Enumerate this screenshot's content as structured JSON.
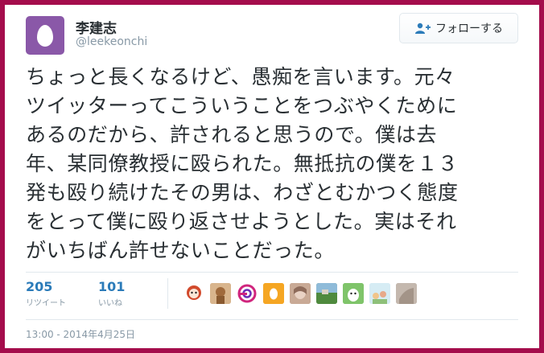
{
  "user": {
    "display_name": "李建志",
    "handle": "@leekeonchi"
  },
  "follow_button": {
    "label": "フォローする",
    "icon": "person-plus-icon"
  },
  "tweet": {
    "text": "ちょっと長くなるけど、愚痴を言います。元々\nツイッターってこういうことをつぶやくために\nあるのだから、許されると思うので。僕は去\n年、某同僚教授に殴られた。無抵抗の僕を１３\n発も殴り続けたその男は、わざとむかつく態度\nをとって僕に殴り返させようとした。実はそれ\nがいちばん許せないことだった。"
  },
  "stats": {
    "retweets": {
      "count": "205",
      "label": "リツイート"
    },
    "likes": {
      "count": "101",
      "label": "いいね"
    }
  },
  "timestamp": "13:00 - 2014年4月25日",
  "colors": {
    "frame": "#a40d4c",
    "accent": "#2b7bb9",
    "avatar_bg": "#8a58a8"
  }
}
